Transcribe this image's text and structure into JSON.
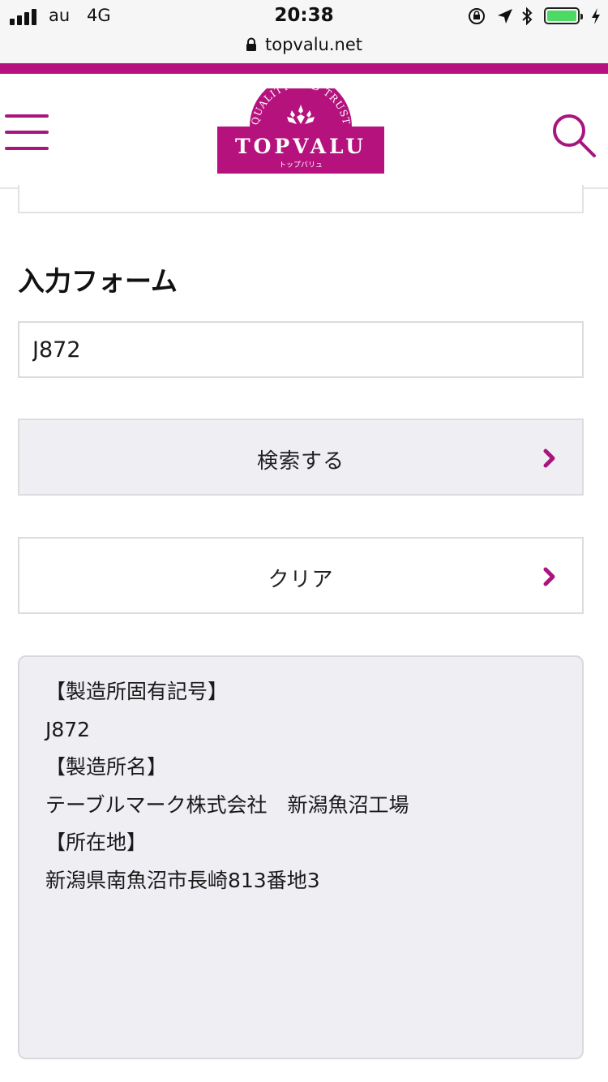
{
  "status_bar": {
    "carrier": "au",
    "network": "4G",
    "time": "20:38",
    "icons": [
      "signal-icon",
      "orientation-lock-icon",
      "location-arrow-icon",
      "bluetooth-icon",
      "battery-icon",
      "charging-bolt-icon"
    ],
    "battery_color": "#4cd964"
  },
  "browser": {
    "url": "topvalu.net",
    "icon": "lock-icon"
  },
  "header": {
    "logo_text": "TOPVALU",
    "logo_tagline": "QUALITY AND TRUST",
    "logo_kana": "トップバリュ",
    "menu_icon": "hamburger-menu-icon",
    "search_icon": "search-icon",
    "brand_color": "#b5127e"
  },
  "form": {
    "title": "入力フォーム",
    "input_value": "J872",
    "search_button": "検索する",
    "clear_button": "クリア"
  },
  "result": {
    "lines": [
      "【製造所固有記号】",
      "J872",
      "【製造所名】",
      "テーブルマーク株式会社　新潟魚沼工場",
      "【所在地】",
      "新潟県南魚沼市長崎813番地3"
    ]
  }
}
